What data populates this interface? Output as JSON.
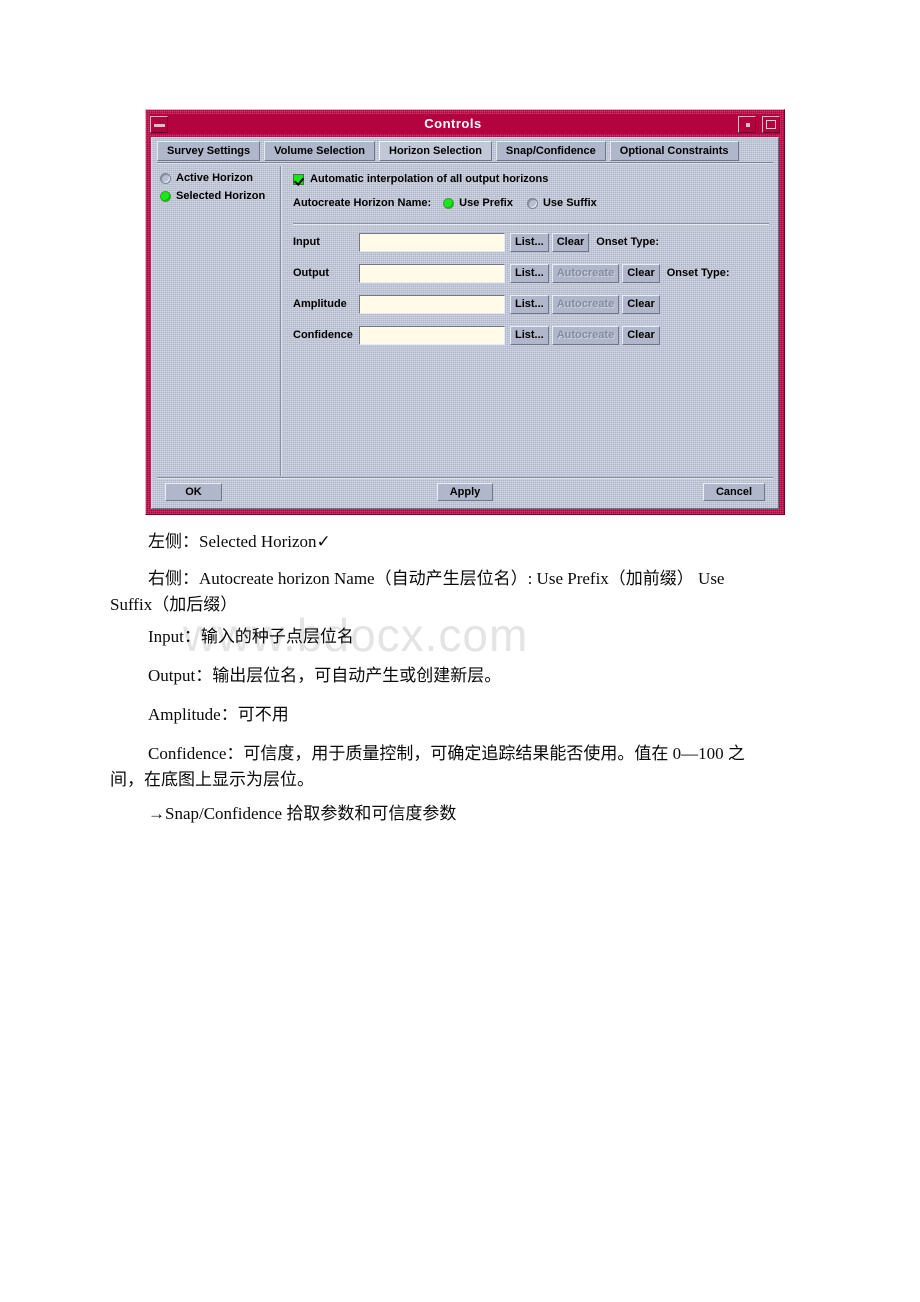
{
  "watermark": {
    "text": "www.bdocx.com"
  },
  "dialog": {
    "title": "Controls",
    "titlebar_buttons": {
      "minimize": "minimize-button",
      "small": "small-button",
      "maximize": "maximize-button"
    },
    "tabs": [
      {
        "label": "Survey Settings",
        "active": false
      },
      {
        "label": "Volume Selection",
        "active": false
      },
      {
        "label": "Horizon Selection",
        "active": true
      },
      {
        "label": "Snap/Confidence",
        "active": false
      },
      {
        "label": "Optional Constraints",
        "active": false
      }
    ],
    "left_pane": {
      "options": [
        {
          "label": "Active Horizon",
          "selected": false
        },
        {
          "label": "Selected Horizon",
          "selected": true
        }
      ]
    },
    "right_pane": {
      "auto_interpolate": {
        "label": "Automatic interpolation of all output horizons",
        "checked": true
      },
      "autocreate_name": {
        "label": "Autocreate Horizon Name:",
        "options": [
          {
            "label": "Use Prefix",
            "selected": true
          },
          {
            "label": "Use Suffix",
            "selected": false
          }
        ]
      },
      "rows": [
        {
          "label": "Input",
          "value": "",
          "list_label": "List...",
          "autocreate_label": null,
          "clear_label": "Clear",
          "onset_label": "Onset Type:"
        },
        {
          "label": "Output",
          "value": "",
          "list_label": "List...",
          "autocreate_label": "Autocreate",
          "clear_label": "Clear",
          "onset_label": "Onset Type:"
        },
        {
          "label": "Amplitude",
          "value": "",
          "list_label": "List...",
          "autocreate_label": "Autocreate",
          "clear_label": "Clear",
          "onset_label": ""
        },
        {
          "label": "Confidence",
          "value": "",
          "list_label": "List...",
          "autocreate_label": "Autocreate",
          "clear_label": "Clear",
          "onset_label": ""
        }
      ]
    },
    "buttons": {
      "ok": "OK",
      "apply": "Apply",
      "cancel": "Cancel"
    }
  },
  "document": {
    "paragraphs": [
      {
        "id": "p1",
        "text": "左侧：Selected Horizon✓"
      },
      {
        "id": "p2",
        "text": "右侧：Autocreate horizon Name（自动产生层位名）: Use Prefix（加前缀） Use",
        "continuation": "Suffix（加后缀）"
      },
      {
        "id": "p3",
        "text": "Input：输入的种子点层位名"
      },
      {
        "id": "p4",
        "text": "Output：输出层位名，可自动产生或创建新层。"
      },
      {
        "id": "p5",
        "text": "Amplitude：可不用"
      },
      {
        "id": "p6",
        "text": "Confidence：可信度，用于质量控制，可确定追踪结果能否使用。值在 0—100 之",
        "continuation": "间，在底图上显示为层位。"
      },
      {
        "id": "p7",
        "text": "→Snap/Confidence 拾取参数和可信度参数"
      }
    ]
  },
  "colors": {
    "window_frame": "#b4043f",
    "client_bg": "#b1b7cb",
    "field_bg": "#fffbe8",
    "selected_green": "#18ea18"
  }
}
